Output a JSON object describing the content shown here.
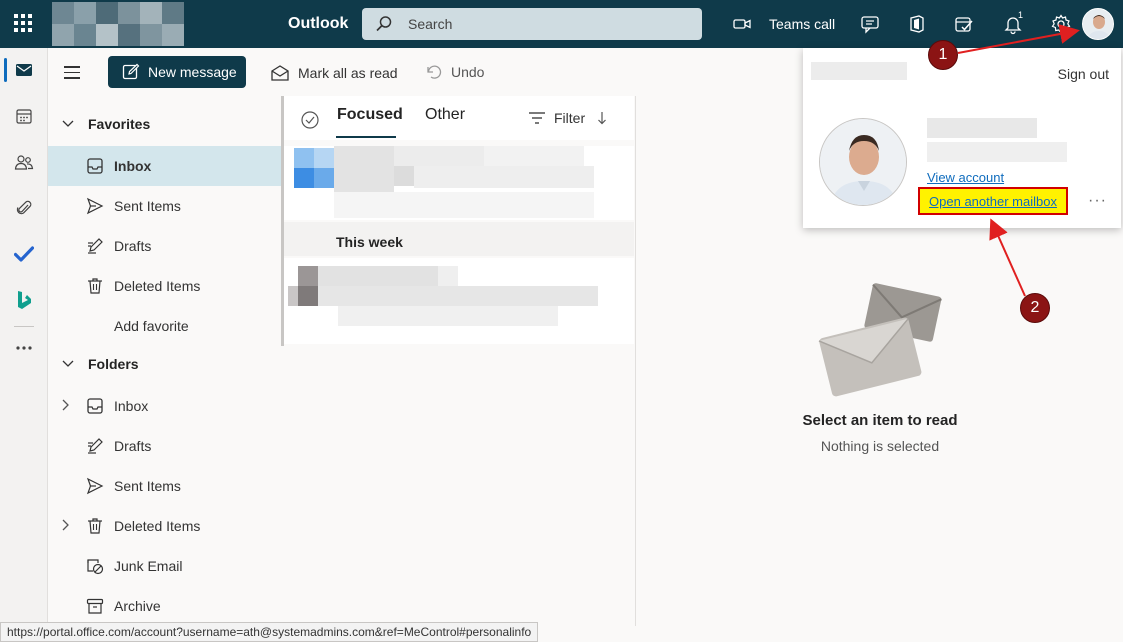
{
  "topbar": {
    "app_title": "Outlook",
    "search_placeholder": "Search",
    "teams_call_label": "Teams call",
    "notification_count": "1"
  },
  "command_bar": {
    "new_message_label": "New message",
    "mark_all_read_label": "Mark all as read",
    "undo_label": "Undo"
  },
  "nav": {
    "favorites_header": "Favorites",
    "favorites": [
      {
        "label": "Inbox",
        "icon": "inbox-icon",
        "selected": true
      },
      {
        "label": "Sent Items",
        "icon": "sent-icon"
      },
      {
        "label": "Drafts",
        "icon": "drafts-icon"
      },
      {
        "label": "Deleted Items",
        "icon": "trash-icon"
      },
      {
        "label": "Add favorite"
      }
    ],
    "folders_header": "Folders",
    "folders": [
      {
        "label": "Inbox",
        "icon": "inbox-icon",
        "expandable": true
      },
      {
        "label": "Drafts",
        "icon": "drafts-icon"
      },
      {
        "label": "Sent Items",
        "icon": "sent-icon"
      },
      {
        "label": "Deleted Items",
        "icon": "trash-icon",
        "expandable": true
      },
      {
        "label": "Junk Email",
        "icon": "junk-icon"
      },
      {
        "label": "Archive",
        "icon": "archive-icon"
      }
    ]
  },
  "message_list": {
    "tab_focused": "Focused",
    "tab_other": "Other",
    "filter_label": "Filter",
    "section_this_week": "This week"
  },
  "reading_pane": {
    "empty_title": "Select an item to read",
    "empty_subtitle": "Nothing is selected"
  },
  "account_panel": {
    "sign_out_label": "Sign out",
    "view_account_label": "View account",
    "open_another_mailbox_label": "Open another mailbox"
  },
  "annotations": {
    "badge_1": "1",
    "badge_2": "2",
    "badge_color": "#8b1414",
    "arrow_color": "#e02020"
  },
  "status_bar": {
    "url": "https://portal.office.com/account?username=ath@systemadmins.com&ref=MeControl#personalinfo"
  },
  "colors": {
    "topbar_bg": "#0f3a4a",
    "selected_nav_bg": "#d3e6ec",
    "link": "#0f6cbd",
    "highlight": "#fff200"
  }
}
